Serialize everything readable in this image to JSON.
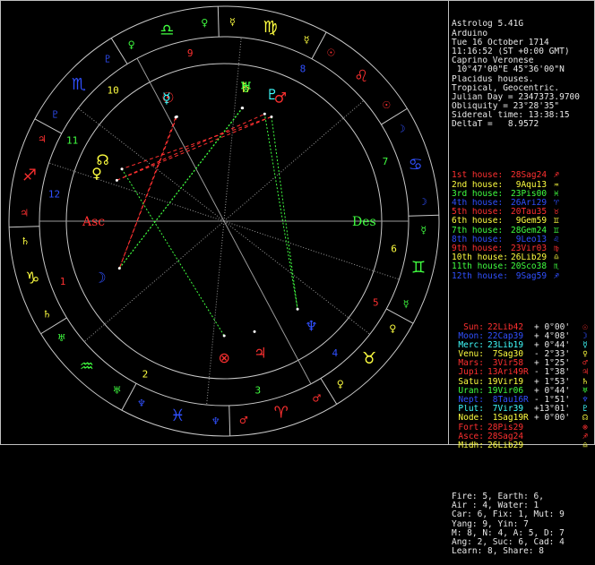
{
  "header": [
    "Astrolog 5.41G",
    "Arduino",
    "Tue 16 October 1714",
    "11:16:52 (ST +0:00 GMT)",
    "Caprino Veronese",
    " 10°47'00\"E 45°36'00\"N",
    "Placidus houses.",
    "Tropical, Geocentric.",
    "Julian Day = 2347373.9700",
    "Obliquity = 23°28'35\"",
    "Sidereal time: 13:38:15",
    "DeltaT =   8.9572"
  ],
  "houses": [
    {
      "label": "1st house:",
      "pos": "28Sag24",
      "glyph": "♐",
      "color": "#ff3030"
    },
    {
      "label": "2nd house:",
      "pos": " 9Aqu13",
      "glyph": "♒",
      "color": "#ffff40"
    },
    {
      "label": "3rd house:",
      "pos": "23Pis00",
      "glyph": "♓",
      "color": "#40ff40"
    },
    {
      "label": "4th house:",
      "pos": "26Ari29",
      "glyph": "♈",
      "color": "#3050ff"
    },
    {
      "label": "5th house:",
      "pos": "20Tau35",
      "glyph": "♉",
      "color": "#ff3030"
    },
    {
      "label": "6th house:",
      "pos": " 9Gem59",
      "glyph": "♊",
      "color": "#ffff40"
    },
    {
      "label": "7th house:",
      "pos": "28Gem24",
      "glyph": "♊",
      "color": "#40ff40"
    },
    {
      "label": "8th house:",
      "pos": " 9Leo13",
      "glyph": "♌",
      "color": "#3050ff"
    },
    {
      "label": "9th house:",
      "pos": "23Vir03",
      "glyph": "♍",
      "color": "#ff3030"
    },
    {
      "label": "10th house:",
      "pos": "26Lib29",
      "glyph": "♎",
      "color": "#ffff40"
    },
    {
      "label": "11th house:",
      "pos": "20Sco38",
      "glyph": "♏",
      "color": "#40ff40"
    },
    {
      "label": "12th house:",
      "pos": " 9Sag59",
      "glyph": "♐",
      "color": "#3050ff"
    }
  ],
  "planets": [
    {
      "name": "Sun:",
      "pos": "22Lib42",
      "lat": "+ 0°00'",
      "glyph": "☉",
      "color": "#ff3030"
    },
    {
      "name": "Moon:",
      "pos": "22Cap39",
      "lat": "+ 4°08'",
      "glyph": "☽",
      "color": "#3050ff"
    },
    {
      "name": "Merc:",
      "pos": "23Lib19",
      "lat": "+ 0°44'",
      "glyph": "☿",
      "color": "#40ffff"
    },
    {
      "name": "Venu:",
      "pos": " 7Sag30",
      "lat": "- 2°33'",
      "glyph": "♀",
      "color": "#ffff40"
    },
    {
      "name": "Mars:",
      "pos": " 3Vir58",
      "lat": "+ 1°25'",
      "glyph": "♂",
      "color": "#ff3030"
    },
    {
      "name": "Jupi:",
      "pos": "13Ari49R",
      "lat": "- 1°38'",
      "glyph": "♃",
      "color": "#ff3030"
    },
    {
      "name": "Satu:",
      "pos": "19Vir19",
      "lat": "+ 1°53'",
      "glyph": "♄",
      "color": "#ffff40"
    },
    {
      "name": "Uran:",
      "pos": "19Vir06",
      "lat": "+ 0°44'",
      "glyph": "♅",
      "color": "#40ff40"
    },
    {
      "name": "Nept:",
      "pos": " 8Tau16R",
      "lat": "- 1°51'",
      "glyph": "♆",
      "color": "#3050ff"
    },
    {
      "name": "Plut:",
      "pos": " 7Vir39",
      "lat": "+13°01'",
      "glyph": "♇",
      "color": "#40ffff"
    },
    {
      "name": "Node:",
      "pos": " 1Sag19R",
      "lat": "+ 0°00'",
      "glyph": "☊",
      "color": "#ffff40"
    },
    {
      "name": "Fort:",
      "pos": "28Pis29",
      "lat": "",
      "glyph": "⊗",
      "color": "#ff3030"
    },
    {
      "name": "Asce:",
      "pos": "28Sag24",
      "lat": "",
      "glyph": "♐",
      "color": "#ff3030"
    },
    {
      "name": "Midh:",
      "pos": "26Lib29",
      "lat": "",
      "glyph": "♎",
      "color": "#ffff40"
    }
  ],
  "summary": [
    "Fire: 5, Earth: 6,",
    "Air : 4, Water: 1",
    "Car: 6, Fix: 1, Mut: 9",
    "Yang: 9, Yin: 7",
    "M: 8, N: 4, A: 5, D: 7",
    "Ang: 2, Suc: 6, Cad: 4",
    "Learn: 8, Share: 8"
  ],
  "wheel": {
    "axis_labels": {
      "asc": "Asc",
      "des": "Des"
    },
    "house_numbers": [
      "1",
      "2",
      "3",
      "4",
      "5",
      "6",
      "7",
      "8",
      "9",
      "10",
      "11",
      "12"
    ],
    "signs": [
      {
        "glyph": "♈",
        "color": "#ff3030"
      },
      {
        "glyph": "♉",
        "color": "#ffff40"
      },
      {
        "glyph": "♊",
        "color": "#40ff40"
      },
      {
        "glyph": "♋",
        "color": "#3050ff"
      },
      {
        "glyph": "♌",
        "color": "#ff3030"
      },
      {
        "glyph": "♍",
        "color": "#ffff40"
      },
      {
        "glyph": "♎",
        "color": "#40ff40"
      },
      {
        "glyph": "♏",
        "color": "#3050ff"
      },
      {
        "glyph": "♐",
        "color": "#ff3030"
      },
      {
        "glyph": "♑",
        "color": "#ffff40"
      },
      {
        "glyph": "♒",
        "color": "#40ff40"
      },
      {
        "glyph": "♓",
        "color": "#3050ff"
      }
    ],
    "ruler_glyphs": [
      {
        "glyph": "♂",
        "color": "#ff3030"
      },
      {
        "glyph": "♀",
        "color": "#ffff40"
      },
      {
        "glyph": "☿",
        "color": "#40ff40"
      },
      {
        "glyph": "☽",
        "color": "#3050ff"
      },
      {
        "glyph": "☉",
        "color": "#ff3030"
      },
      {
        "glyph": "☿",
        "color": "#ffff40"
      },
      {
        "glyph": "♀",
        "color": "#40ff40"
      },
      {
        "glyph": "♇",
        "color": "#3050ff"
      },
      {
        "glyph": "♃",
        "color": "#ff3030"
      },
      {
        "glyph": "♄",
        "color": "#ffff40"
      },
      {
        "glyph": "♅",
        "color": "#40ff40"
      },
      {
        "glyph": "♆",
        "color": "#3050ff"
      }
    ]
  }
}
